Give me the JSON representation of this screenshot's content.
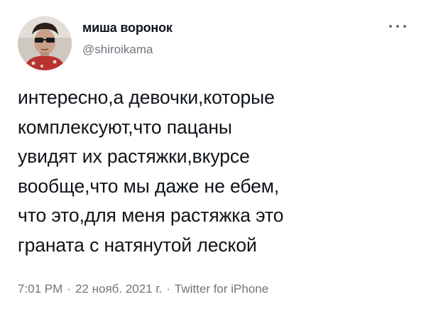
{
  "tweet": {
    "author": {
      "display_name": "миша воронок",
      "handle": "@shiroikama",
      "avatar": "user-avatar-photo"
    },
    "more_icon": "more-horizontal-icon",
    "text": "интересно,а девочки,которые\nкомплексуют,что пацаны\nувидят их растяжки,вкурсе\nвообще,что мы даже не ебем,\nчто это,для меня растяжка это\nграната с натянутой леской",
    "meta": {
      "time": "7:01 PM",
      "separator": "·",
      "date": "22 нояб. 2021 г.",
      "source": "Twitter for iPhone"
    }
  },
  "colors": {
    "text_primary": "#0f1419",
    "text_secondary": "#6e767d",
    "background": "#ffffff"
  }
}
